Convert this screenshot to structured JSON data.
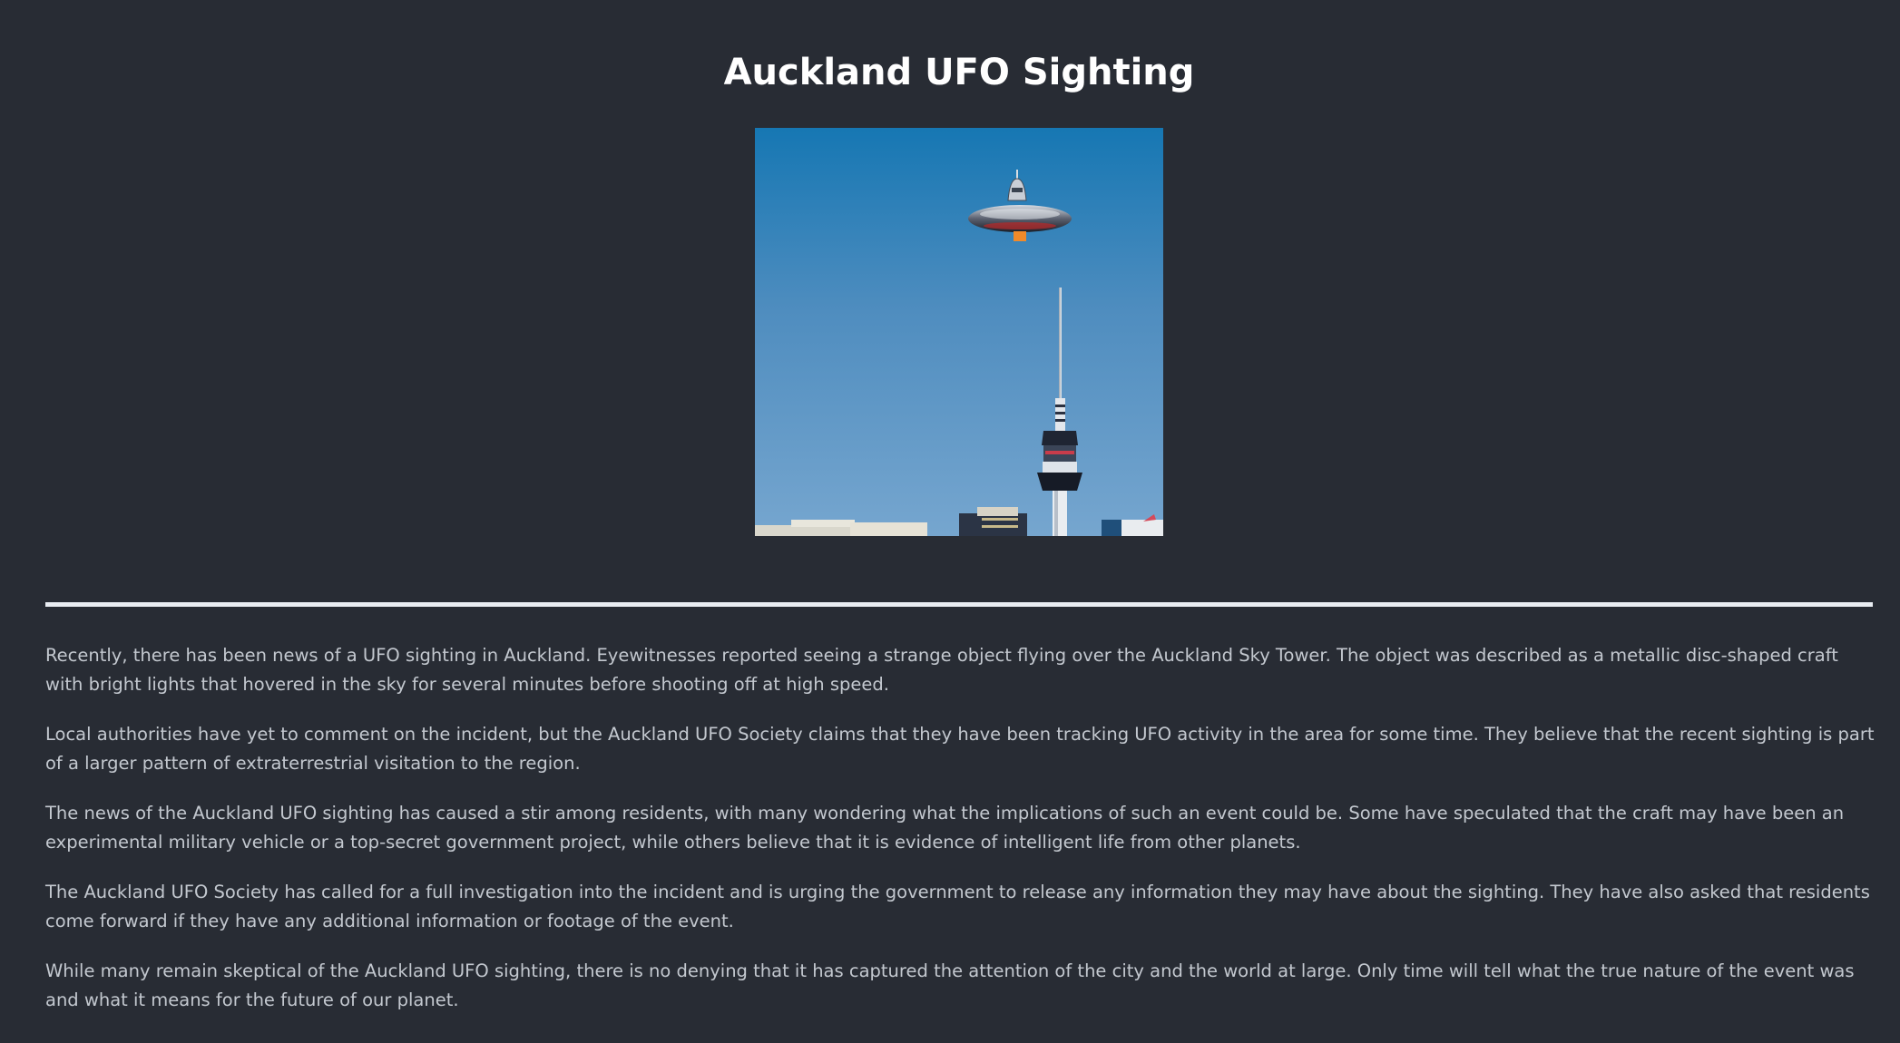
{
  "page": {
    "title": "Auckland UFO Sighting",
    "background_color": "#282c34",
    "text_color": "#c3c8cf"
  },
  "hero_image": {
    "subject": "ufo-over-sky-tower-photo"
  },
  "article": {
    "paragraphs": [
      "Recently, there has been news of a UFO sighting in Auckland. Eyewitnesses reported seeing a strange object flying over the Auckland Sky Tower. The object was described as a metallic disc-shaped craft with bright lights that hovered in the sky for several minutes before shooting off at high speed.",
      "Local authorities have yet to comment on the incident, but the Auckland UFO Society claims that they have been tracking UFO activity in the area for some time. They believe that the recent sighting is part of a larger pattern of extraterrestrial visitation to the region.",
      "The news of the Auckland UFO sighting has caused a stir among residents, with many wondering what the implications of such an event could be. Some have speculated that the craft may have been an experimental military vehicle or a top-secret government project, while others believe that it is evidence of intelligent life from other planets.",
      "The Auckland UFO Society has called for a full investigation into the incident and is urging the government to release any information they may have about the sighting. They have also asked that residents come forward if they have any additional information or footage of the event.",
      "While many remain skeptical of the Auckland UFO sighting, there is no denying that it has captured the attention of the city and the world at large. Only time will tell what the true nature of the event was and what it means for the future of our planet."
    ]
  }
}
